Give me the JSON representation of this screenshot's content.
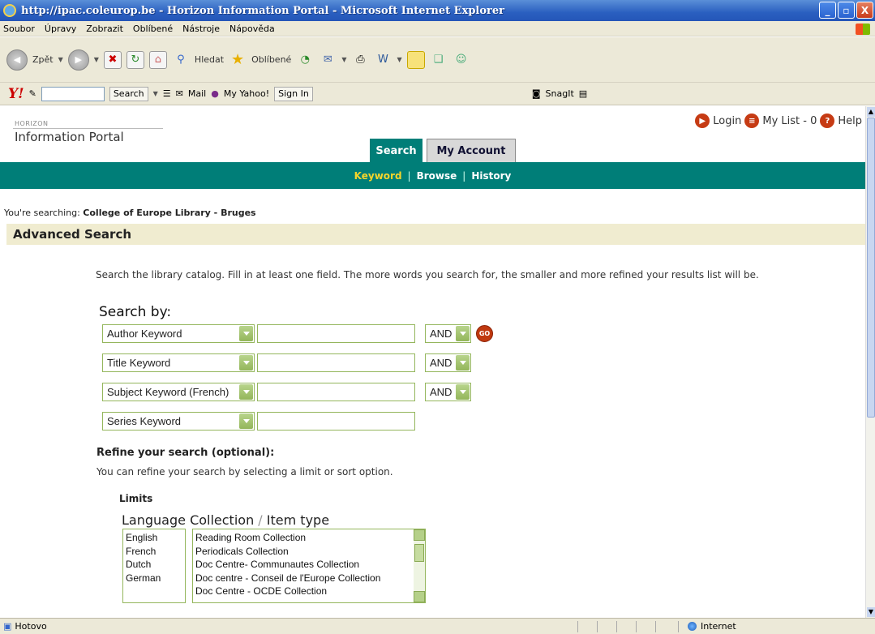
{
  "window": {
    "title": "http://ipac.coleurop.be - Horizon Information Portal - Microsoft Internet Explorer",
    "minimize": "_",
    "maximize": "▫",
    "close": "X"
  },
  "menu": [
    "Soubor",
    "Úpravy",
    "Zobrazit",
    "Oblíbené",
    "Nástroje",
    "Nápověda"
  ],
  "toolbar": {
    "back": "Zpět",
    "search": "Hledat",
    "favorites": "Oblíbené"
  },
  "yahoo_bar": {
    "search_button": "Search",
    "mail": "Mail",
    "my_yahoo": "My Yahoo!",
    "sign_in": "Sign In",
    "snagit": "SnagIt"
  },
  "portal": {
    "logo_small": "HORIZON",
    "logo_main": "Information Portal",
    "links": {
      "login": "Login",
      "mylist": "My List - 0",
      "help": "Help"
    },
    "tabs": {
      "search": "Search",
      "account": "My Account"
    },
    "subnav": {
      "keyword": "Keyword",
      "browse": "Browse",
      "history": "History"
    },
    "searching_prefix": "You're searching:",
    "searching_library": "College of Europe Library - Bruges",
    "heading": "Advanced Search",
    "instructions": "Search the library catalog. Fill in at least one field. The more words you search for, the smaller and more refined your results list will be.",
    "search_by": "Search by:",
    "rows": [
      {
        "field": "Author Keyword",
        "op": "AND"
      },
      {
        "field": "Title Keyword",
        "op": "AND"
      },
      {
        "field": "Subject Keyword (French)",
        "op": "AND"
      },
      {
        "field": "Series Keyword",
        "op": ""
      }
    ],
    "go": "GO",
    "refine_title": "Refine your search (optional):",
    "refine_sub": "You can refine your search by selecting a limit or sort option.",
    "limits": "Limits",
    "language_label": "Language",
    "collection_label": "Collection",
    "item_type_label": "Item type",
    "languages": [
      "English",
      "French",
      "Dutch",
      "German"
    ],
    "collections": [
      "Reading Room Collection",
      "Periodicals Collection",
      "Doc Centre- Communautes Collection",
      "Doc centre - Conseil de l'Europe Collection",
      "Doc Centre - OCDE Collection"
    ]
  },
  "status": {
    "left": "Hotovo",
    "zone": "Internet"
  }
}
